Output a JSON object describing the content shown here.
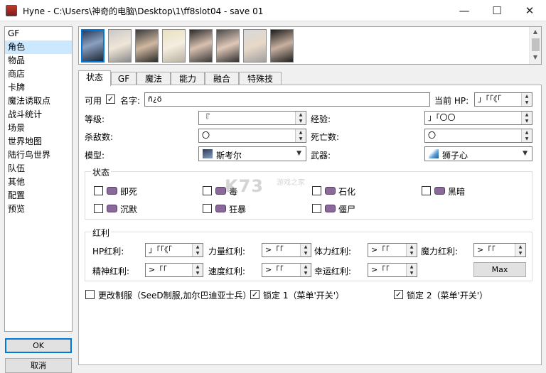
{
  "titlebar": {
    "title": "Hyne - C:\\Users\\神奇的电脑\\Desktop\\1\\ff8slot04 - save 01",
    "min": "—",
    "max": "☐",
    "close": "✕"
  },
  "sidebar": {
    "items": [
      "GF",
      "角色",
      "物品",
      "商店",
      "卡牌",
      "魔法诱取点",
      "战斗统计",
      "场景",
      "世界地图",
      "陆行鸟世界",
      "队伍",
      "其他",
      "配置",
      "预览"
    ],
    "selected_index": 1
  },
  "buttons": {
    "ok": "OK",
    "cancel": "取消",
    "max": "Max"
  },
  "tabs": [
    "状态",
    "GF",
    "魔法",
    "能力",
    "融合",
    "特殊技"
  ],
  "status_tab": {
    "enabled_label": "可用",
    "enabled_check": "✓",
    "name_label": "名字:",
    "name_value": "ñ¿ö",
    "current_hp_label": "当前 HP:",
    "current_hp_value": "」「「《「",
    "level_label": "等级:",
    "level_value": "『",
    "exp_label": "经验:",
    "exp_value": "」「〇〇",
    "kills_label": "杀敌数:",
    "kills_value": "〇",
    "deaths_label": "死亡数:",
    "deaths_value": "〇",
    "model_label": "模型:",
    "model_value": "斯考尔",
    "weapon_label": "武器:",
    "weapon_value": "狮子心"
  },
  "status_group": {
    "title": "状态",
    "items": [
      "即死",
      "毒",
      "石化",
      "黑暗",
      "沉默",
      "狂暴",
      "僵尸"
    ]
  },
  "bonus_group": {
    "title": "红利",
    "hp_label": "HP红利:",
    "hp_value": "」「「《「",
    "str_label": "力量红利:",
    "str_value": ">「「",
    "vit_label": "体力红利:",
    "vit_value": ">「「",
    "mag_label": "魔力红利:",
    "mag_value": ">「「",
    "spr_label": "精神红利:",
    "spr_value": ">「「",
    "spd_label": "速度红利:",
    "spd_value": ">「「",
    "luck_label": "幸运红利:",
    "luck_value": ">「「"
  },
  "bottom": {
    "uniform_label": "更改制服（SeeD制服,加尔巴迪亚士兵）",
    "lock1_label": "锁定 1（菜单'开关'）",
    "lock1_check": "✓",
    "lock2_label": "锁定 2（菜单'开关'）",
    "lock2_check": "✓"
  },
  "watermark": {
    "text": "K73",
    "sub": "游戏之家"
  }
}
